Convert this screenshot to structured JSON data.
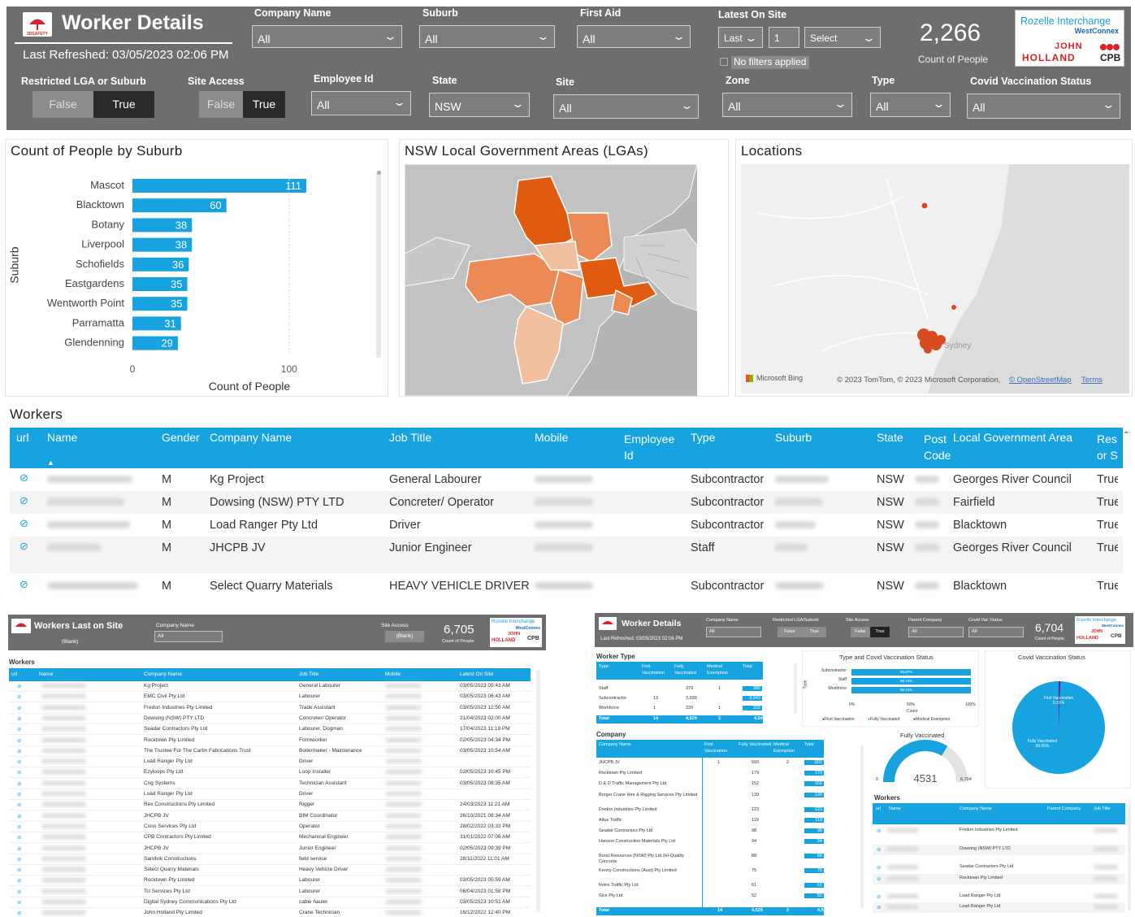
{
  "header": {
    "title": "Worker Details",
    "last_refreshed": "Last Refreshed: 03/05/2023 02:06 PM",
    "kpi_value": "2,266",
    "kpi_label": "Count of People",
    "brand_line1": "Rozelle Interchange",
    "brand_line2": "WestConnex",
    "brand_jh1": "JOHN",
    "brand_jh2": "HOLLAND",
    "brand_cpb": "CPB",
    "app_logo_text": "3DSAFETY"
  },
  "filters": {
    "company_name": {
      "label": "Company Name",
      "value": "All"
    },
    "suburb": {
      "label": "Suburb",
      "value": "All"
    },
    "first_aid": {
      "label": "First Aid",
      "value": "All"
    },
    "latest_on_site": {
      "label": "Latest On Site",
      "period": "Last",
      "count": "1",
      "unit": "Select",
      "status": "No filters applied"
    },
    "restricted_lga": {
      "label": "Restricted LGA or Suburb",
      "false_label": "False",
      "true_label": "True"
    },
    "site_access": {
      "label": "Site Access",
      "false_label": "False",
      "true_label": "True"
    },
    "employee_id": {
      "label": "Employee Id",
      "value": "All"
    },
    "state": {
      "label": "State",
      "value": "NSW"
    },
    "site": {
      "label": "Site",
      "value": "All"
    },
    "zone": {
      "label": "Zone",
      "value": "All"
    },
    "type": {
      "label": "Type",
      "value": "All"
    },
    "covid": {
      "label": "Covid Vaccination Status",
      "value": "All"
    }
  },
  "chart_data": {
    "type": "bar",
    "title": "Count of People by Suburb",
    "xlabel": "Count of People",
    "ylabel": "Suburb",
    "categories": [
      "Mascot",
      "Blacktown",
      "Botany",
      "Liverpool",
      "Schofields",
      "Eastgardens",
      "Wentworth Point",
      "Parramatta",
      "Glendenning"
    ],
    "values": [
      111,
      60,
      38,
      38,
      36,
      35,
      35,
      31,
      29
    ],
    "xticks": [
      "0",
      "100"
    ],
    "xlim": [
      0,
      120
    ],
    "grid": false
  },
  "map_lga": {
    "title": "NSW Local Government Areas (LGAs)"
  },
  "map_locations": {
    "title": "Locations",
    "city_label": "Sydney",
    "bing": "Microsoft Bing",
    "attribution": "© 2023 TomTom, © 2023 Microsoft Corporation,",
    "osm": "© OpenStreetMap",
    "terms": "Terms"
  },
  "workers": {
    "title": "Workers",
    "columns": [
      "url",
      "Name",
      "Gender",
      "Company Name",
      "Job Title",
      "Mobile",
      "Employee Id",
      "Type",
      "Suburb",
      "State",
      "Post Code",
      "Local Government Area",
      "Res or S"
    ],
    "rows": [
      {
        "gender": "M",
        "company": "Kg Project",
        "job": "General Labourer",
        "type": "Subcontractor",
        "state": "NSW",
        "lga": "Georges River Council",
        "res": "True"
      },
      {
        "gender": "M",
        "company": "Dowsing (NSW) PTY LTD",
        "job": "Concreter/ Operator",
        "type": "Subcontractor",
        "state": "NSW",
        "lga": "Fairfield",
        "res": "True"
      },
      {
        "gender": "M",
        "company": "Load Ranger Pty Ltd",
        "job": "Driver",
        "type": "Subcontractor",
        "state": "NSW",
        "lga": "Blacktown",
        "res": "True"
      },
      {
        "gender": "M",
        "company": "JHCPB JV",
        "job": "Junior Engineer",
        "type": "Staff",
        "state": "NSW",
        "lga": "Georges River Council",
        "res": "True"
      },
      {
        "gender": "M",
        "company": "Select Quarry Materials",
        "job": "HEAVY VEHICLE DRIVER",
        "type": "Subcontractor",
        "state": "NSW",
        "lga": "Blacktown",
        "res": "True"
      }
    ]
  },
  "thumb_left": {
    "title": "Workers Last on Site",
    "blank": "(Blank)",
    "company_label": "Company Name",
    "company_value": "All",
    "site_access_label": "Site Access",
    "site_access_value": "(Blank)",
    "kpi": "6,705",
    "kpi_label": "Count of People",
    "table_title": "Workers",
    "columns": [
      "url",
      "Name",
      "Company Name",
      "Job Title",
      "Mobile",
      "Latest On Site"
    ],
    "rows": [
      [
        "Kg Project",
        "General Labourer",
        "03/05/2023 05:43 AM"
      ],
      [
        "EMC Civil Pty Ltd",
        "Labourer",
        "03/05/2023 06:43 AM"
      ],
      [
        "Fredon Industries Pty Limited",
        "Trade Assistant",
        "03/05/2023 12:50 AM"
      ],
      [
        "Dowsing (NSW) PTY LTD",
        "Concreter/ Operator",
        "21/04/2023 02:00 AM"
      ],
      [
        "Seadar Contractors Pty Ltd",
        "Labourer, Dogman",
        "17/04/2023 11:19 PM"
      ],
      [
        "Rocktown Pty Limited",
        "Formworker",
        "02/05/2023 04:34 PM"
      ],
      [
        "The Trustee For The Cartin Fabrications Trust",
        "Boilermaker - Maintenance",
        "03/05/2023 10:54 AM"
      ],
      [
        "Load Ranger Pty Ltd",
        "Driver",
        ""
      ],
      [
        "Ezyloops Pty Ltd",
        "Loop Installer",
        "02/05/2023 10:45 PM"
      ],
      [
        "Cng Systems",
        "Technician Assistant",
        "03/05/2023 08:35 AM"
      ],
      [
        "Load Ranger Pty Ltd",
        "Driver",
        ""
      ],
      [
        "Rex Constructions Pty Limited",
        "Rigger",
        "24/03/2023 11:21 AM"
      ],
      [
        "JHCPB JV",
        "BIM Coordinator",
        "26/10/2021 08:34 AM"
      ],
      [
        "Cono Services Pty Ltd",
        "Operator",
        "28/02/2022 03:33 PM"
      ],
      [
        "CPB Contractors Pty Limited",
        "Mechanical Engineer",
        "31/01/2022 07:06 AM"
      ],
      [
        "JHCPB JV",
        "Junior Engineer",
        "02/05/2023 09:39 PM"
      ],
      [
        "Sandvik Constructions",
        "field service",
        "28/11/2022 11:01 AM"
      ],
      [
        "Select Quarry Materials",
        "Heavy Vehicle Driver",
        ""
      ],
      [
        "Rocktown Pty Limited",
        "Labourer",
        "03/05/2023 05:59 AM"
      ],
      [
        "Tcl Services Pty Ltd",
        "Labourer",
        "06/04/2023 01:58 PM"
      ],
      [
        "Digital Sydney Communications Pty Ltd",
        "cable hauler",
        "03/05/2023 10:51 AM"
      ],
      [
        "John Holland Pty Limited",
        "Crane Technician",
        "16/12/2022 12:40 PM"
      ]
    ]
  },
  "thumb_right": {
    "title": "Worker Details",
    "refreshed": "Last Refreshed: 03/05/2023 02:06 PM",
    "filters": [
      {
        "label": "Company Name",
        "value": "All"
      },
      {
        "label": "Restricted LGA/Suburb",
        "value": ""
      },
      {
        "label": "Site Access",
        "value": ""
      },
      {
        "label": "Parent Company",
        "value": "All"
      },
      {
        "label": "Covid Vac Status",
        "value": "All"
      }
    ],
    "toggle_false": "False",
    "toggle_true": "True",
    "kpi": "6,704",
    "kpi_label": "Count of People",
    "worker_type": {
      "title": "Worker Type",
      "columns": [
        "Type",
        "First Vaccination",
        "Fully Vaccinated",
        "Medical Exemption",
        "Total"
      ],
      "rows": [
        [
          "Staff",
          "",
          "379",
          "1",
          "380"
        ],
        [
          "Subcontractor",
          "13",
          "3,930",
          "",
          "3,943"
        ],
        [
          "Workforce",
          "1",
          "220",
          "1",
          "222"
        ]
      ],
      "total": [
        "Total",
        "14",
        "4,529",
        "2",
        "4,545"
      ]
    },
    "type_covid": {
      "title": "Type and Covid Vaccination Status",
      "axis_label": "Type",
      "rows": [
        [
          "Subcontractor",
          "99.67%"
        ],
        [
          "Staff",
          "99.74%"
        ],
        [
          "Workforce",
          "99.10%"
        ]
      ],
      "ticks": [
        "0%",
        "50%",
        "100%"
      ],
      "xlabel": "Count",
      "legend": [
        "First Vaccination",
        "Fully Vaccinated",
        "Medical Exemption"
      ]
    },
    "covid_pie": {
      "title": "Covid Vaccination Status",
      "first_label": "First Vaccination",
      "first_pct": "0.31%",
      "full_label": "Fully Vaccinated",
      "full_pct": "99.65%",
      "first_fraction": 0.0031
    },
    "company": {
      "title": "Company",
      "columns": [
        "Company Name",
        "First Vaccination",
        "Fully Vaccinated",
        "Medical Exemption",
        "Total"
      ],
      "rows": [
        [
          "JHCPB JV",
          "1",
          "599",
          "2",
          "602"
        ],
        [
          "Rocktown Pty Limited",
          "",
          "179",
          "",
          "179"
        ],
        [
          "D & D Traffic Management Pty Ltd",
          "",
          "152",
          "",
          "152"
        ],
        [
          "Borger Crane Hire & Rigging Services Pty Limited",
          "",
          "139",
          "",
          "139"
        ],
        [
          "Fredon Industries Pty Limited",
          "",
          "123",
          "",
          "123"
        ],
        [
          "Altus Traffic",
          "",
          "119",
          "",
          "119"
        ],
        [
          "Seadar Contractors Pty Ltd",
          "",
          "98",
          "",
          "98"
        ],
        [
          "Hanson Construction Materials Pty Ltd",
          "",
          "94",
          "",
          "94"
        ],
        [
          "Boral Resources (NSW) Pty Ltd (Hi-Quality Concrete",
          "",
          "88",
          "",
          "88"
        ],
        [
          "Kenny Constructions (Aust) Pty Limited",
          "",
          "75",
          "",
          "75"
        ],
        [
          "Retro Traffic Pty Ltd",
          "",
          "61",
          "",
          "61"
        ],
        [
          "Sice Pty Ltd",
          "",
          "52",
          "",
          "52"
        ]
      ],
      "total": [
        "Total",
        "14",
        "4,529",
        "2",
        "4,545"
      ]
    },
    "gauge": {
      "title": "Fully Vaccinated",
      "value": "4531",
      "min": "0",
      "max": "6,704",
      "fraction": 0.676
    },
    "workers": {
      "title": "Workers",
      "columns": [
        "url",
        "Name",
        "Company Name",
        "Parent Company",
        "Job Title"
      ],
      "rows": [
        "Fredon Industries Pty Limited",
        "Dowsing (NSW) PTY LTD",
        "Seadar Contractors Pty Ltd",
        "Rocktown Pty Limited",
        "Load Ranger Pty Ltd",
        "Load Ranger Pty Ltd"
      ]
    }
  },
  "colors": {
    "accent": "#16a3df",
    "header_bg": "#6e6e6e",
    "map_dark": "#e05a0f",
    "map_mid": "#eb8a55",
    "map_light": "#f2bf9e"
  }
}
